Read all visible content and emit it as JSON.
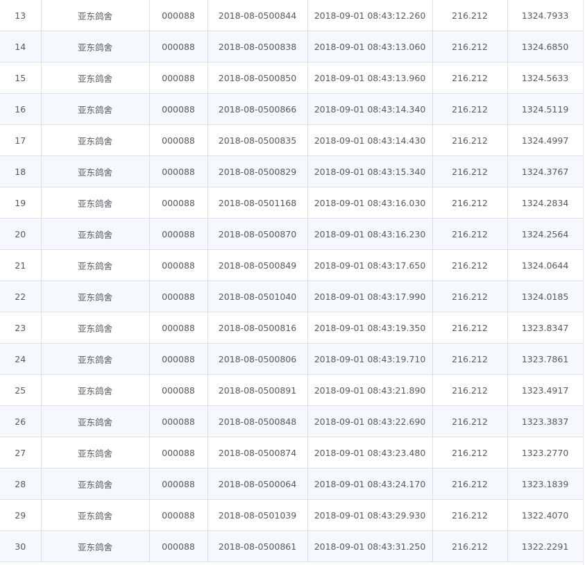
{
  "table": {
    "rows": [
      {
        "rank": "13",
        "loft": "亚东鸽舍",
        "owner_id": "000088",
        "ring": "2018-08-0500844",
        "arrival": "2018-09-01 08:43:12.260",
        "distance": "216.212",
        "speed": "1324.7933"
      },
      {
        "rank": "14",
        "loft": "亚东鸽舍",
        "owner_id": "000088",
        "ring": "2018-08-0500838",
        "arrival": "2018-09-01 08:43:13.060",
        "distance": "216.212",
        "speed": "1324.6850"
      },
      {
        "rank": "15",
        "loft": "亚东鸽舍",
        "owner_id": "000088",
        "ring": "2018-08-0500850",
        "arrival": "2018-09-01 08:43:13.960",
        "distance": "216.212",
        "speed": "1324.5633"
      },
      {
        "rank": "16",
        "loft": "亚东鸽舍",
        "owner_id": "000088",
        "ring": "2018-08-0500866",
        "arrival": "2018-09-01 08:43:14.340",
        "distance": "216.212",
        "speed": "1324.5119"
      },
      {
        "rank": "17",
        "loft": "亚东鸽舍",
        "owner_id": "000088",
        "ring": "2018-08-0500835",
        "arrival": "2018-09-01 08:43:14.430",
        "distance": "216.212",
        "speed": "1324.4997"
      },
      {
        "rank": "18",
        "loft": "亚东鸽舍",
        "owner_id": "000088",
        "ring": "2018-08-0500829",
        "arrival": "2018-09-01 08:43:15.340",
        "distance": "216.212",
        "speed": "1324.3767"
      },
      {
        "rank": "19",
        "loft": "亚东鸽舍",
        "owner_id": "000088",
        "ring": "2018-08-0501168",
        "arrival": "2018-09-01 08:43:16.030",
        "distance": "216.212",
        "speed": "1324.2834"
      },
      {
        "rank": "20",
        "loft": "亚东鸽舍",
        "owner_id": "000088",
        "ring": "2018-08-0500870",
        "arrival": "2018-09-01 08:43:16.230",
        "distance": "216.212",
        "speed": "1324.2564"
      },
      {
        "rank": "21",
        "loft": "亚东鸽舍",
        "owner_id": "000088",
        "ring": "2018-08-0500849",
        "arrival": "2018-09-01 08:43:17.650",
        "distance": "216.212",
        "speed": "1324.0644"
      },
      {
        "rank": "22",
        "loft": "亚东鸽舍",
        "owner_id": "000088",
        "ring": "2018-08-0501040",
        "arrival": "2018-09-01 08:43:17.990",
        "distance": "216.212",
        "speed": "1324.0185"
      },
      {
        "rank": "23",
        "loft": "亚东鸽舍",
        "owner_id": "000088",
        "ring": "2018-08-0500816",
        "arrival": "2018-09-01 08:43:19.350",
        "distance": "216.212",
        "speed": "1323.8347"
      },
      {
        "rank": "24",
        "loft": "亚东鸽舍",
        "owner_id": "000088",
        "ring": "2018-08-0500806",
        "arrival": "2018-09-01 08:43:19.710",
        "distance": "216.212",
        "speed": "1323.7861"
      },
      {
        "rank": "25",
        "loft": "亚东鸽舍",
        "owner_id": "000088",
        "ring": "2018-08-0500891",
        "arrival": "2018-09-01 08:43:21.890",
        "distance": "216.212",
        "speed": "1323.4917"
      },
      {
        "rank": "26",
        "loft": "亚东鸽舍",
        "owner_id": "000088",
        "ring": "2018-08-0500848",
        "arrival": "2018-09-01 08:43:22.690",
        "distance": "216.212",
        "speed": "1323.3837"
      },
      {
        "rank": "27",
        "loft": "亚东鸽舍",
        "owner_id": "000088",
        "ring": "2018-08-0500874",
        "arrival": "2018-09-01 08:43:23.480",
        "distance": "216.212",
        "speed": "1323.2770"
      },
      {
        "rank": "28",
        "loft": "亚东鸽舍",
        "owner_id": "000088",
        "ring": "2018-08-0500064",
        "arrival": "2018-09-01 08:43:24.170",
        "distance": "216.212",
        "speed": "1323.1839"
      },
      {
        "rank": "29",
        "loft": "亚东鸽舍",
        "owner_id": "000088",
        "ring": "2018-08-0501039",
        "arrival": "2018-09-01 08:43:29.930",
        "distance": "216.212",
        "speed": "1322.4070"
      },
      {
        "rank": "30",
        "loft": "亚东鸽舍",
        "owner_id": "000088",
        "ring": "2018-08-0500861",
        "arrival": "2018-09-01 08:43:31.250",
        "distance": "216.212",
        "speed": "1322.2291"
      }
    ]
  },
  "colors": {
    "row_odd_bg": "#ffffff",
    "row_even_bg": "#f5f8fd",
    "border": "#dcdfe6",
    "text": "#555a61"
  }
}
